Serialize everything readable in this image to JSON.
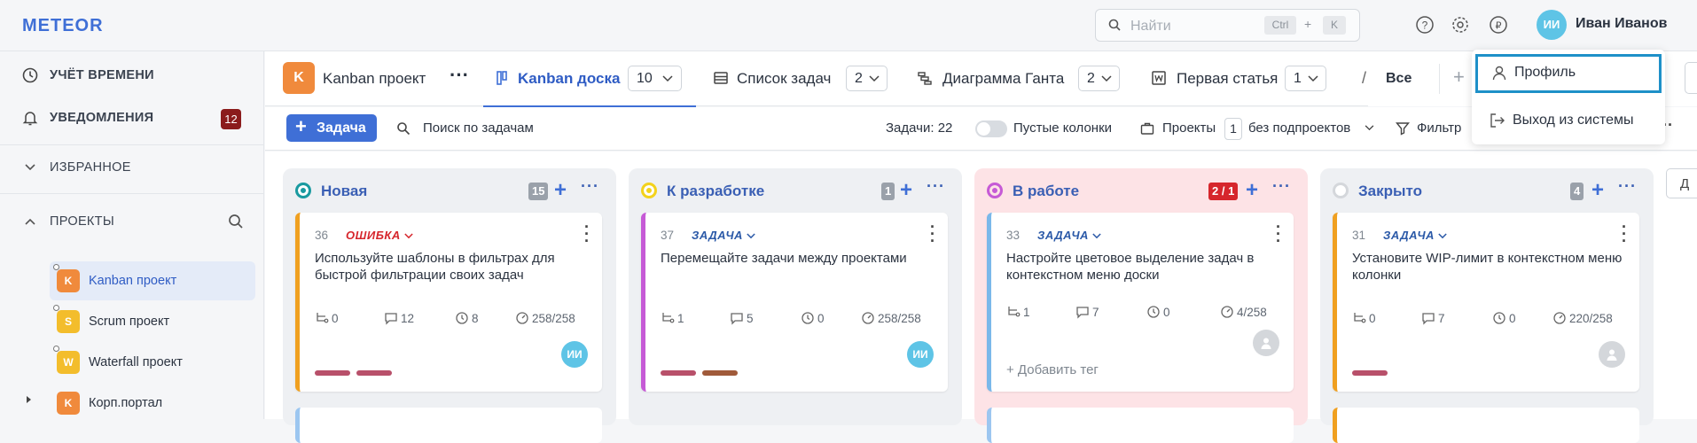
{
  "app": {
    "logo": "METEOR"
  },
  "search": {
    "placeholder": "Найти",
    "kbd1": "Ctrl",
    "plus": "+",
    "kbd2": "K"
  },
  "user": {
    "initials": "ИИ",
    "name": "Иван Иванов"
  },
  "sidebar": {
    "time": "УЧЁТ ВРЕМЕНИ",
    "notifications": "УВЕДОМЛЕНИЯ",
    "notifications_count": "12",
    "favorites": "ИЗБРАННОЕ",
    "projects": "ПРОЕКТЫ",
    "project_list": [
      {
        "initial": "K",
        "name": "Kanban проект",
        "color": "#f08a3c"
      },
      {
        "initial": "S",
        "name": "Scrum проект",
        "color": "#f3bd2c"
      },
      {
        "initial": "W",
        "name": "Waterfall проект",
        "color": "#f3bd2c"
      },
      {
        "initial": "K",
        "name": "Корп.портал",
        "color": "#f08a3c"
      }
    ]
  },
  "project_header": {
    "initial": "K",
    "name": "Kanban проект",
    "more": "···"
  },
  "tabs": [
    {
      "label": "Kanban доска",
      "count": "10"
    },
    {
      "label": "Список задач",
      "count": "2"
    },
    {
      "label": "Диаграмма Ганта",
      "count": "2"
    },
    {
      "label": "Первая статья",
      "count": "1"
    }
  ],
  "tab_dropdown": {
    "all": "Все"
  },
  "user_menu": {
    "profile": "Профиль",
    "logout": "Выход из системы"
  },
  "toolbar": {
    "add": "Задача",
    "search": "Поиск по задачам",
    "tasks": "Задачи: 22",
    "empty_cols": "Пустые колонки",
    "projects": "Проекты",
    "projects_num": "1",
    "subprojects": "без подпроектов",
    "filter": "Фильтр"
  },
  "columns": [
    {
      "title": "Новая",
      "count": "15",
      "ring": "#1a9aa0",
      "card": {
        "num": "36",
        "type": "ОШИБКА",
        "type_color": "#d6262c",
        "text": "Используйте шаблоны в фильтрах для быстрой фильтрации своих задач",
        "subtasks": "0",
        "comments": "12",
        "time": "8",
        "progress": "258/258",
        "assignee": "ИИ",
        "border": "#f0a020",
        "tags": [
          "#b8506a",
          "#b8506a"
        ]
      }
    },
    {
      "title": "К разработке",
      "count": "1",
      "ring": "#f3d21c",
      "card": {
        "num": "37",
        "type": "ЗАДАЧА",
        "type_color": "#2c5aa8",
        "text": "Перемещайте задачи между проектами",
        "subtasks": "1",
        "comments": "5",
        "time": "0",
        "progress": "258/258",
        "assignee": "ИИ",
        "border": "#c65ad6",
        "tags": [
          "#b8506a",
          "#a05a3a"
        ]
      }
    },
    {
      "title": "В работе",
      "count": "2 / 1",
      "ring": "#c65ad6",
      "card": {
        "num": "33",
        "type": "ЗАДАЧА",
        "type_color": "#2c5aa8",
        "text": "Настройте цветовое выделение задач в контекстном меню доски",
        "subtasks": "1",
        "comments": "7",
        "time": "0",
        "progress": "4/258",
        "assignee": "",
        "border": "#7ab8ea",
        "add_tag": "+ Добавить тег",
        "tags": []
      }
    },
    {
      "title": "Закрыто",
      "count": "4",
      "ring": "#d4d7db",
      "card": {
        "num": "31",
        "type": "ЗАДАЧА",
        "type_color": "#2c5aa8",
        "text": "Установите WIP-лимит в контекстном меню колонки",
        "subtasks": "0",
        "comments": "7",
        "time": "0",
        "progress": "220/258",
        "assignee": "",
        "border": "#f0a020",
        "tags": [
          "#b8506a"
        ]
      }
    }
  ]
}
